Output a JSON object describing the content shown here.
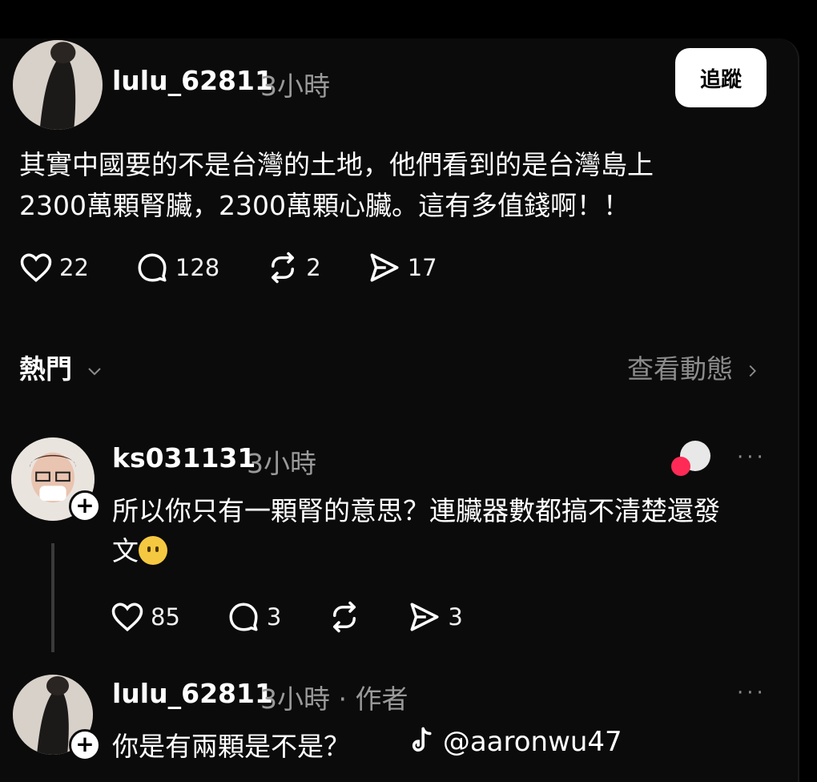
{
  "post": {
    "username": "lulu_62811",
    "time": "3小時",
    "follow_label": "追蹤",
    "text_line1": "其實中國要的不是台灣的土地，他們看到的是台灣島上",
    "text_line2": "2300萬顆腎臟，2300萬顆心臟。這有多值錢啊！！",
    "likes": "22",
    "comments": "128",
    "reposts": "2",
    "shares": "17"
  },
  "section": {
    "title": "熱門",
    "link": "查看動態"
  },
  "reply1": {
    "username": "ks031131",
    "time": "3小時",
    "text_line1": "所以你只有一顆腎的意思？連臟器數都搞不清楚還發",
    "text_line2": "文",
    "likes": "85",
    "comments": "3",
    "shares": "3",
    "more": "···"
  },
  "reply2": {
    "username": "lulu_62811",
    "time": "3小時 · 作者",
    "text": "你是有兩顆是不是？",
    "more": "···"
  },
  "watermark": "@aaronwu47",
  "icons": [
    "heart-icon",
    "comment-icon",
    "repost-icon",
    "share-icon",
    "chevron-down-icon",
    "chevron-right-icon",
    "more-icon",
    "plus-icon",
    "tiktok-icon"
  ]
}
